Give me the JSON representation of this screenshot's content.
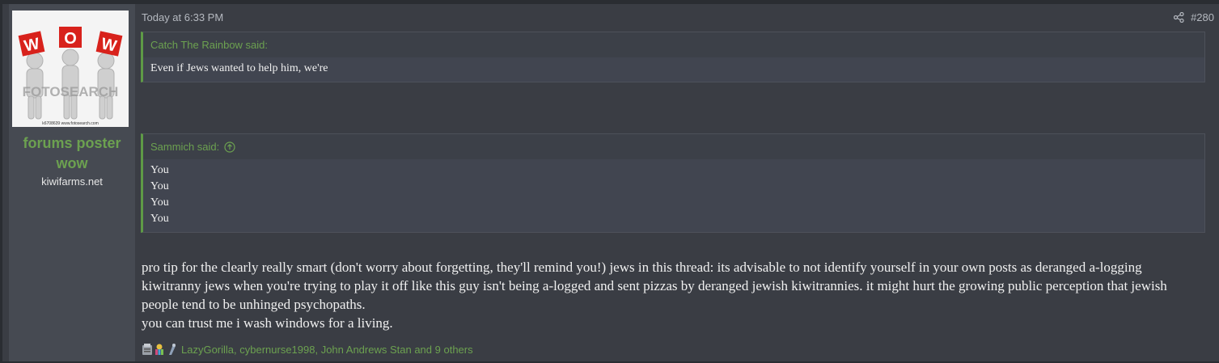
{
  "post": {
    "timestamp": "Today at 6:33 PM",
    "post_number": "#280",
    "share_icon": "share-icon"
  },
  "user": {
    "name_line1": "forums poster",
    "name_line2": "wow",
    "title": "kiwifarms.net",
    "avatar": {
      "letters": [
        "W",
        "O",
        "W"
      ],
      "watermark": "FOTOSEARCH",
      "caption": "k6708639 www.fotosearch.com"
    }
  },
  "quotes": [
    {
      "author_label": "Catch The Rainbow said:",
      "lines": [
        "Even if Jews wanted to help him, we're"
      ]
    },
    {
      "author_label": "Sammich said:",
      "jump_icon": "arrow-up-circle-icon",
      "lines": [
        "You",
        "You",
        "You",
        "You"
      ]
    }
  ],
  "body": {
    "paragraph": "pro tip for the clearly really smart (don't worry about forgetting, they'll remind you!) jews in this thread: its advisable to not identify yourself in your own posts as deranged a-logging kiwitranny jews when you're trying to play it off like this guy isn't being a-logged and sent pizzas by deranged jewish kiwitrannies. it might hurt the growing public perception that jewish people tend to be unhinged psychopaths.",
    "line2": "you can trust me i wash windows for a living."
  },
  "reactions": {
    "icons": [
      "informative-icon",
      "rainbow-icon",
      "feels-icon"
    ],
    "text": "LazyGorilla, cybernurse1998, John Andrews Stan and 9 others"
  },
  "colors": {
    "accent_green": "#6ca150",
    "background": "#3a3d44",
    "sidebar": "#464a52",
    "quote_border": "#5e9a46"
  }
}
